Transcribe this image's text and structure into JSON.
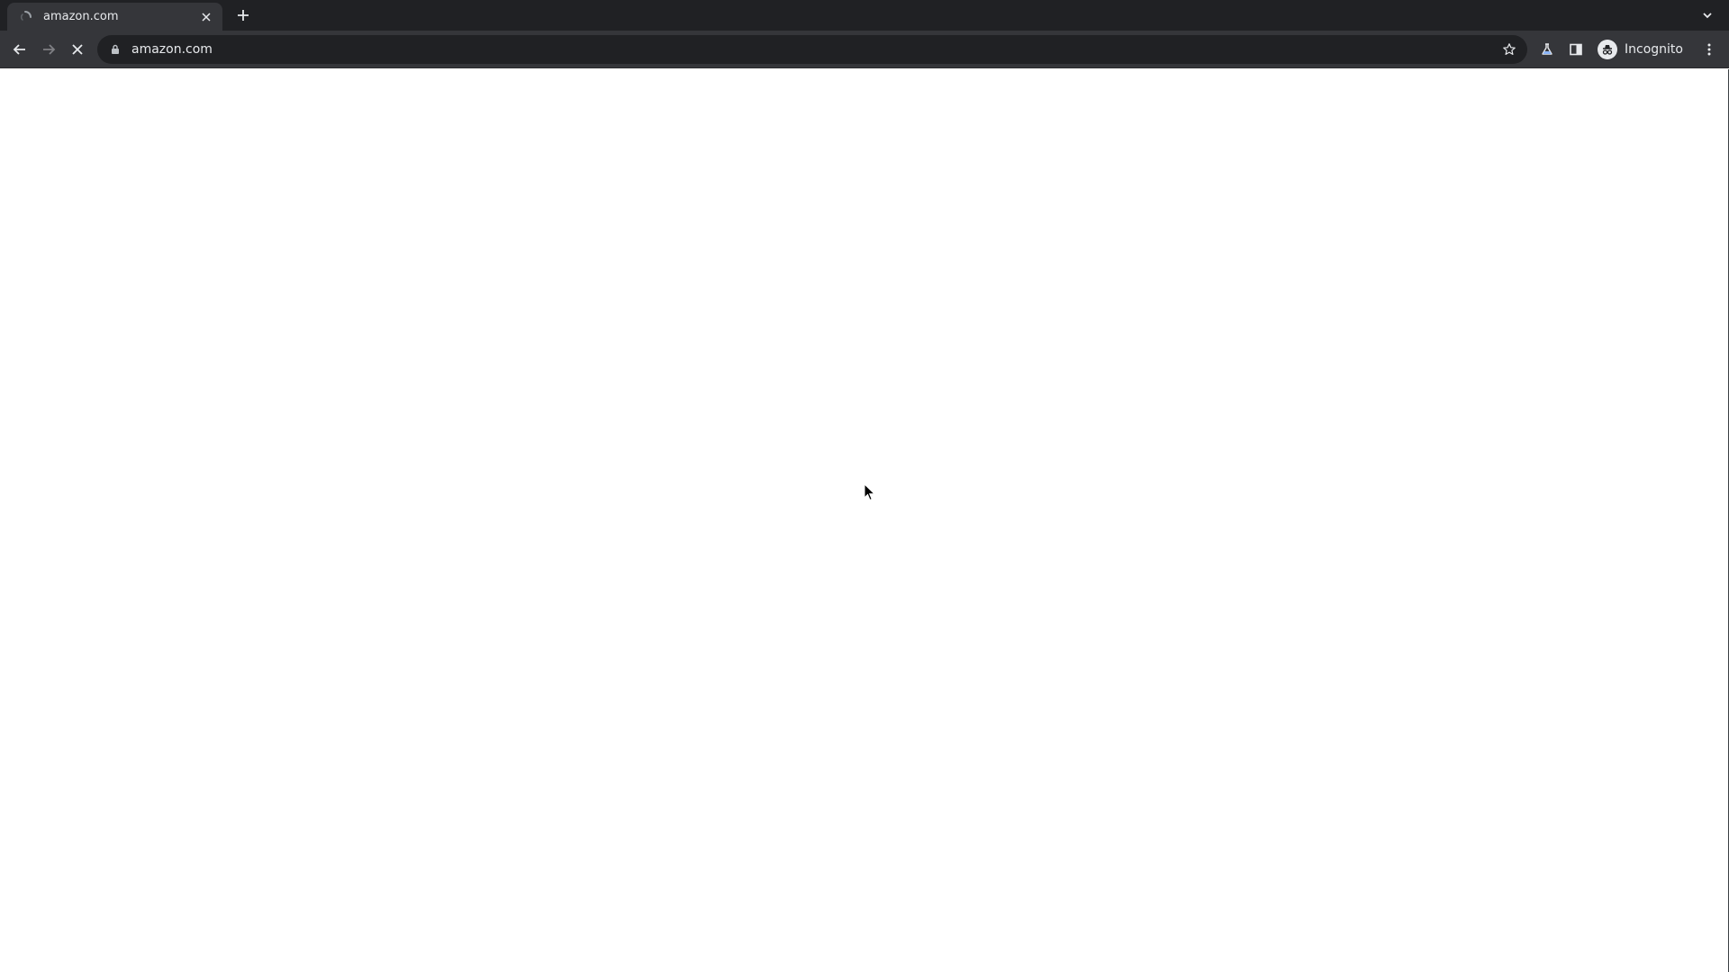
{
  "browser": {
    "tab": {
      "title": "amazon.com",
      "favicon": "loading-favicon-icon"
    },
    "new_tab_icon": "plus-icon",
    "tab_search_icon": "chevron-down-icon",
    "toolbar": {
      "back_icon": "arrow-left-icon",
      "forward_icon": "arrow-right-icon",
      "stop_icon": "close-icon",
      "omnibox": {
        "url": "amazon.com",
        "lock_icon": "lock-icon",
        "star_icon": "star-icon"
      },
      "labs_icon": "flask-icon",
      "side_panel_icon": "side-panel-icon",
      "profile_label": "Incognito",
      "menu_icon": "more-vertical-icon"
    }
  },
  "colors": {
    "tab_strip_bg": "#202124",
    "toolbar_bg": "#35363a",
    "omnibox_bg": "#202124",
    "text": "#e8eaed",
    "icon": "#e8eaed",
    "page_bg": "#ffffff"
  }
}
